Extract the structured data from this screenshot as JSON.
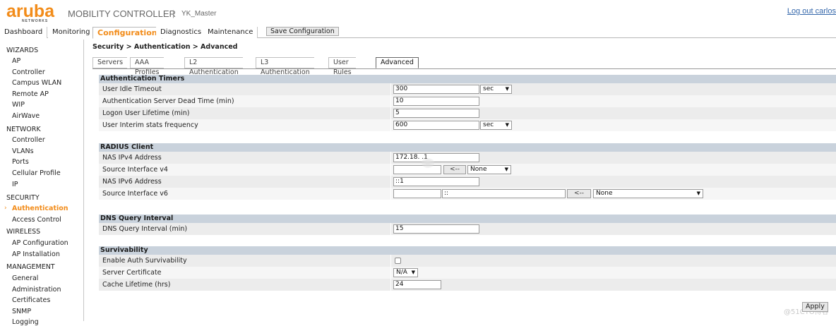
{
  "header": {
    "logo": "aruba",
    "logo_sub": "NETWORKS",
    "product": "MOBILITY CONTROLLER",
    "separator": "|",
    "controller": "YK_Master",
    "logout": "Log out carlos"
  },
  "topnav": {
    "tabs": [
      "Dashboard",
      "Monitoring",
      "Configuration",
      "Diagnostics",
      "Maintenance"
    ],
    "active": "Configuration",
    "save_label": "Save Configuration"
  },
  "sidebar": {
    "wizards": {
      "title": "WIZARDS",
      "items": [
        "AP",
        "Controller",
        "Campus WLAN",
        "Remote AP",
        "WIP",
        "AirWave"
      ]
    },
    "network": {
      "title": "NETWORK",
      "items": [
        "Controller",
        "VLANs",
        "Ports",
        "Cellular Profile",
        "IP"
      ]
    },
    "security": {
      "title": "SECURITY",
      "items": [
        "Authentication",
        "Access Control"
      ]
    },
    "wireless": {
      "title": "WIRELESS",
      "items": [
        "AP Configuration",
        "AP Installation"
      ]
    },
    "management": {
      "title": "MANAGEMENT",
      "items": [
        "General",
        "Administration",
        "Certificates",
        "SNMP",
        "Logging"
      ]
    }
  },
  "breadcrumb": "Security > Authentication > Advanced",
  "subtabs": [
    "Servers",
    "AAA Profiles",
    "L2 Authentication",
    "L3 Authentication",
    "User Rules",
    "Advanced"
  ],
  "sections": {
    "timers": {
      "title": "Authentication Timers",
      "idle_label": "User Idle Timeout",
      "idle_value": "300",
      "idle_unit": "sec",
      "dead_label": "Authentication Server Dead Time (min)",
      "dead_value": "10",
      "logon_label": "Logon User Lifetime (min)",
      "logon_value": "5",
      "interim_label": "User Interim stats frequency",
      "interim_value": "600",
      "interim_unit": "sec"
    },
    "radius": {
      "title": "RADIUS Client",
      "nas4_label": "NAS IPv4 Address",
      "nas4_value": "172.18.   .1",
      "src4_label": "Source Interface v4",
      "src4_btn": "<--",
      "src4_select": "None",
      "nas6_label": "NAS IPv6 Address",
      "nas6_value": "::1",
      "src6_label": "Source Interface v6",
      "src6_value": "::",
      "src6_btn": "<--",
      "src6_select": "None"
    },
    "dns": {
      "title": "DNS Query Interval",
      "label": "DNS Query Interval (min)",
      "value": "15"
    },
    "surv": {
      "title": "Survivability",
      "enable_label": "Enable Auth Survivability",
      "cert_label": "Server Certificate",
      "cert_value": "N/A",
      "cache_label": "Cache Lifetime (hrs)",
      "cache_value": "24"
    }
  },
  "apply_label": "Apply",
  "watermark": "@51CTO博客",
  "colors": {
    "accent": "#f28c1a",
    "section_header": "#c9d2dc",
    "link": "#3366aa"
  }
}
